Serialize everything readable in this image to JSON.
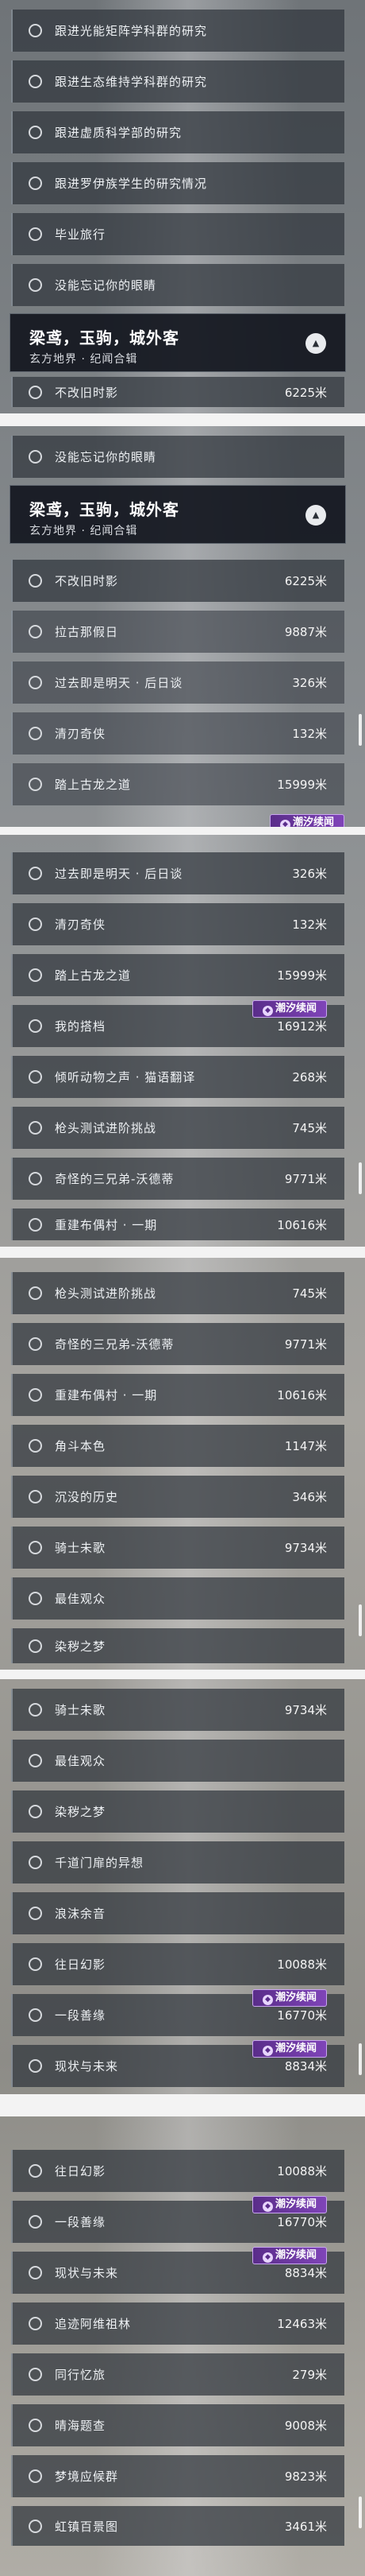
{
  "screens": [
    {
      "top": 0,
      "rows_before": [
        {
          "title": "跟进光能矩阵学科群的研究",
          "dist": ""
        },
        {
          "title": "跟进生态维持学科群的研究",
          "dist": ""
        },
        {
          "title": "跟进虚质科学部的研究",
          "dist": ""
        },
        {
          "title": "跟进罗伊族学生的研究情况",
          "dist": ""
        },
        {
          "title": "毕业旅行",
          "dist": ""
        },
        {
          "title": "没能忘记你的眼睛",
          "dist": ""
        }
      ],
      "header": {
        "title": "梁鸢，玉驹，城外客",
        "subtitle": "玄方地界 · 纪闻合辑"
      },
      "rows_after": [
        {
          "title": "不改旧时影",
          "dist": "6225米"
        }
      ]
    }
  ],
  "s1": {
    "r1": "没能忘记你的眼睛",
    "header_title": "梁鸢，玉驹，城外客",
    "header_sub": "玄方地界 · 纪闻合辑",
    "rows": [
      {
        "title": "不改旧时影",
        "dist": "6225米"
      },
      {
        "title": "拉古那假日",
        "dist": "9887米"
      },
      {
        "title": "过去即是明天 · 后日谈",
        "dist": "326米"
      },
      {
        "title": "清刃奇侠",
        "dist": "132米"
      },
      {
        "title": "踏上古龙之道",
        "dist": "15999米"
      }
    ]
  },
  "s2": {
    "rows": [
      {
        "title": "过去即是明天 · 后日谈",
        "dist": "326米"
      },
      {
        "title": "清刃奇侠",
        "dist": "132米"
      },
      {
        "title": "踏上古龙之道",
        "dist": "15999米"
      },
      {
        "title": "我的搭档",
        "dist": "16912米"
      },
      {
        "title": "倾听动物之声 · 猫语翻译",
        "dist": "268米"
      },
      {
        "title": "枪头测试进阶挑战",
        "dist": "745米"
      },
      {
        "title": "奇怪的三兄弟-沃德蒂",
        "dist": "9771米"
      },
      {
        "title": "重建布偶村 · 一期",
        "dist": "10616米"
      }
    ]
  },
  "s3": {
    "rows": [
      {
        "title": "枪头测试进阶挑战",
        "dist": "745米"
      },
      {
        "title": "奇怪的三兄弟-沃德蒂",
        "dist": "9771米"
      },
      {
        "title": "重建布偶村 · 一期",
        "dist": "10616米"
      },
      {
        "title": "角斗本色",
        "dist": "1147米"
      },
      {
        "title": "沉没的历史",
        "dist": "346米"
      },
      {
        "title": "骑士未歌",
        "dist": "9734米"
      },
      {
        "title": "最佳观众",
        "dist": ""
      },
      {
        "title": "染秽之梦",
        "dist": ""
      }
    ]
  },
  "s4": {
    "rows": [
      {
        "title": "骑士未歌",
        "dist": "9734米"
      },
      {
        "title": "最佳观众",
        "dist": ""
      },
      {
        "title": "染秽之梦",
        "dist": ""
      },
      {
        "title": "千道门扉的异想",
        "dist": ""
      },
      {
        "title": "浪沫余音",
        "dist": ""
      },
      {
        "title": "往日幻影",
        "dist": "10088米"
      },
      {
        "title": "一段善缘",
        "dist": "16770米"
      },
      {
        "title": "现状与未来",
        "dist": "8834米"
      }
    ]
  },
  "s5": {
    "rows": [
      {
        "title": "往日幻影",
        "dist": "10088米"
      },
      {
        "title": "一段善缘",
        "dist": "16770米"
      },
      {
        "title": "现状与未来",
        "dist": "8834米"
      },
      {
        "title": "追迹阿维祖林",
        "dist": "12463米"
      },
      {
        "title": "同行忆旅",
        "dist": "279米"
      },
      {
        "title": "晴海题查",
        "dist": "9008米"
      },
      {
        "title": "梦境应候群",
        "dist": "9823米"
      },
      {
        "title": "虹镇百景图",
        "dist": "3461米"
      }
    ]
  },
  "badge_label": "潮汐续闻",
  "icons": {
    "radio": "radio-circle-icon",
    "collapse": "chevron-up-icon",
    "badge": "tide-icon"
  },
  "colors": {
    "row_bg": "#2f343c",
    "header_bg": "#12161e",
    "badge": "#6b37a0",
    "divider": "#f3f3f3"
  }
}
